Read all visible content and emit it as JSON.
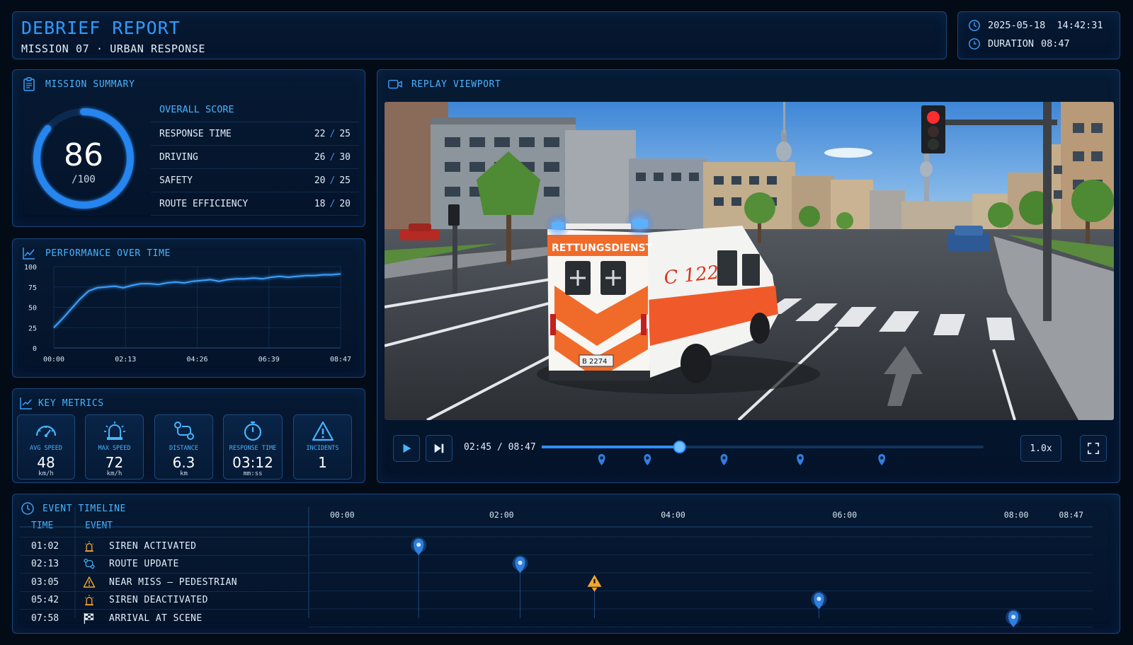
{
  "header": {
    "title": "DEBRIEF REPORT",
    "subtitle": "MISSION 07 · URBAN RESPONSE",
    "datetime": "2025-05-18  14:42:31",
    "duration_label": "DURATION",
    "duration_value": "08:47"
  },
  "summary": {
    "title": "MISSION SUMMARY",
    "score": "86",
    "score_max": "/100",
    "score_fraction": 0.86,
    "overall_label": "OVERALL SCORE",
    "rows": [
      {
        "label": "RESPONSE TIME",
        "value": "22",
        "max": "25"
      },
      {
        "label": "DRIVING",
        "value": "26",
        "max": "30"
      },
      {
        "label": "SAFETY",
        "value": "20",
        "max": "25"
      },
      {
        "label": "ROUTE EFFICIENCY",
        "value": "18",
        "max": "20"
      }
    ]
  },
  "performance": {
    "title": "PERFORMANCE OVER TIME"
  },
  "chart_data": {
    "type": "line",
    "title": "PERFORMANCE OVER TIME",
    "xlabel": "",
    "ylabel": "",
    "ylim": [
      0,
      100
    ],
    "yticks": [
      "0",
      "25",
      "50",
      "75",
      "100"
    ],
    "xticks": [
      "00:00",
      "02:13",
      "04:26",
      "06:39",
      "08:47"
    ],
    "grid": true,
    "series": [
      {
        "values": [
          25,
          36,
          48,
          60,
          70,
          74,
          75,
          76,
          74,
          77,
          79,
          79,
          78,
          80,
          81,
          80,
          82,
          83,
          84,
          82,
          84,
          85,
          85,
          86,
          85,
          87,
          88,
          87,
          88,
          89,
          89,
          90,
          90,
          91
        ]
      }
    ]
  },
  "metrics": {
    "title": "KEY METRICS",
    "items": [
      {
        "label": "AVG SPEED",
        "value": "48",
        "unit": "km/h",
        "icon": "speedometer-icon"
      },
      {
        "label": "MAX SPEED",
        "value": "72",
        "unit": "km/h",
        "icon": "siren-icon"
      },
      {
        "label": "DISTANCE",
        "value": "6.3",
        "unit": "km",
        "icon": "route-icon"
      },
      {
        "label": "RESPONSE TIME",
        "value": "03:12",
        "unit": "mm:ss",
        "icon": "stopwatch-icon"
      },
      {
        "label": "INCIDENTS",
        "value": "1",
        "unit": "",
        "icon": "warning-icon"
      }
    ]
  },
  "viewport": {
    "title": "REPLAY VIEWPORT",
    "time_display": "02:45 / 08:47",
    "progress": 0.313,
    "speed": "1.0x",
    "vehicle_text": "RETTUNGSDIENST",
    "vehicle_number": "C 122",
    "plate": "B 2274",
    "markers": [
      0.136,
      0.24,
      0.414,
      0.587,
      0.772
    ]
  },
  "timeline": {
    "title": "EVENT TIMELINE",
    "col_time": "TIME",
    "col_event": "EVENT",
    "axis_labels": [
      "00:00",
      "02:00",
      "04:00",
      "06:00",
      "08:00",
      "08:47"
    ],
    "axis_max_seconds": 527,
    "events": [
      {
        "time": "01:02",
        "name": "SIREN ACTIVATED",
        "icon": "siren-icon"
      },
      {
        "time": "02:13",
        "name": "ROUTE UPDATE",
        "icon": "route-icon"
      },
      {
        "time": "03:05",
        "name": "NEAR MISS – PEDESTRIAN",
        "icon": "warning-icon"
      },
      {
        "time": "05:42",
        "name": "SIREN DEACTIVATED",
        "icon": "siren-icon"
      },
      {
        "time": "07:58",
        "name": "ARRIVAL AT SCENE",
        "icon": "checkered-flag-icon"
      }
    ]
  },
  "colors": {
    "accent": "#2f9bff",
    "line": "#3aa0ff",
    "warning": "#f0a830",
    "background": "#030b17"
  }
}
